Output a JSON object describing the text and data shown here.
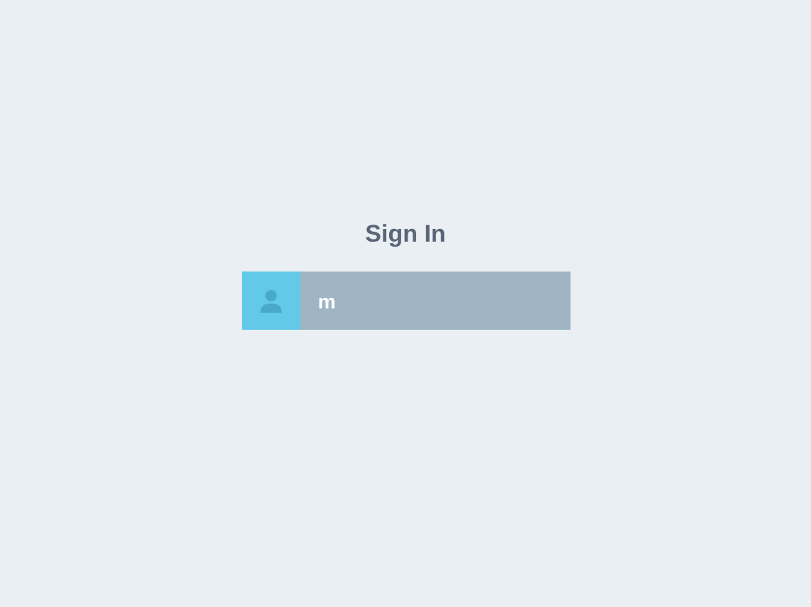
{
  "title": "Sign In",
  "username_field": {
    "value": "m"
  }
}
